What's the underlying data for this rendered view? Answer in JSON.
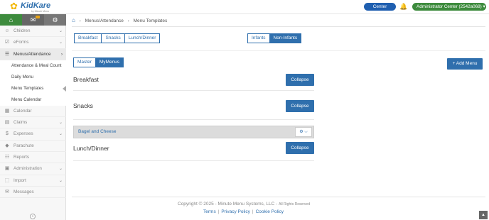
{
  "header": {
    "logo_text": "KidKare",
    "logo_sub": "by Minute Menu",
    "center_label": "Center",
    "admin_label": "Administrator Center (2542a068) ▾"
  },
  "sidebar": {
    "items": [
      {
        "label": "Children",
        "icon": "☺"
      },
      {
        "label": "eForms",
        "icon": "☑"
      },
      {
        "label": "Menus/Attendance",
        "icon": "☰"
      },
      {
        "label": "Calendar",
        "icon": "▦"
      },
      {
        "label": "Claims",
        "icon": "▤"
      },
      {
        "label": "Expenses",
        "icon": "$"
      },
      {
        "label": "Parachute",
        "icon": "◆"
      },
      {
        "label": "Reports",
        "icon": "☷"
      },
      {
        "label": "Administration",
        "icon": "▣"
      },
      {
        "label": "Import",
        "icon": "⬚"
      },
      {
        "label": "Messages",
        "icon": "✉"
      }
    ],
    "sub_items": [
      "Attendance & Meal Count",
      "Daily Menu",
      "Menu Templates",
      "Menu Calendar"
    ]
  },
  "breadcrumb": {
    "items": [
      "Menus/Attendance",
      "Menu Templates"
    ]
  },
  "meal_tabs": [
    "Breakfast",
    "Snacks",
    "Lunch/Dinner"
  ],
  "age_tabs": [
    "Infants",
    "Non-Infants"
  ],
  "menu_tabs": [
    "Master",
    "MyMenus"
  ],
  "add_menu_label": "+ Add Menu",
  "sections": [
    {
      "title": "Breakfast",
      "button": "Collapse"
    },
    {
      "title": "Snacks",
      "button": "Collapse"
    },
    {
      "title": "Lunch/Dinner",
      "button": "Collapse"
    }
  ],
  "menu_row": {
    "name": "Bagel and Cheese",
    "gear": "⚙ ⌵"
  },
  "footer": {
    "copyright": "Copyright © 2025 - Minute Menu Systems, LLC -",
    "rights": "All Rights Reserved",
    "links": [
      "Terms",
      "Privacy Policy",
      "Cookie Policy"
    ]
  },
  "colors": {
    "primary": "#2f6fad",
    "green": "#3d8b3d",
    "center": "#1f5fb0"
  }
}
